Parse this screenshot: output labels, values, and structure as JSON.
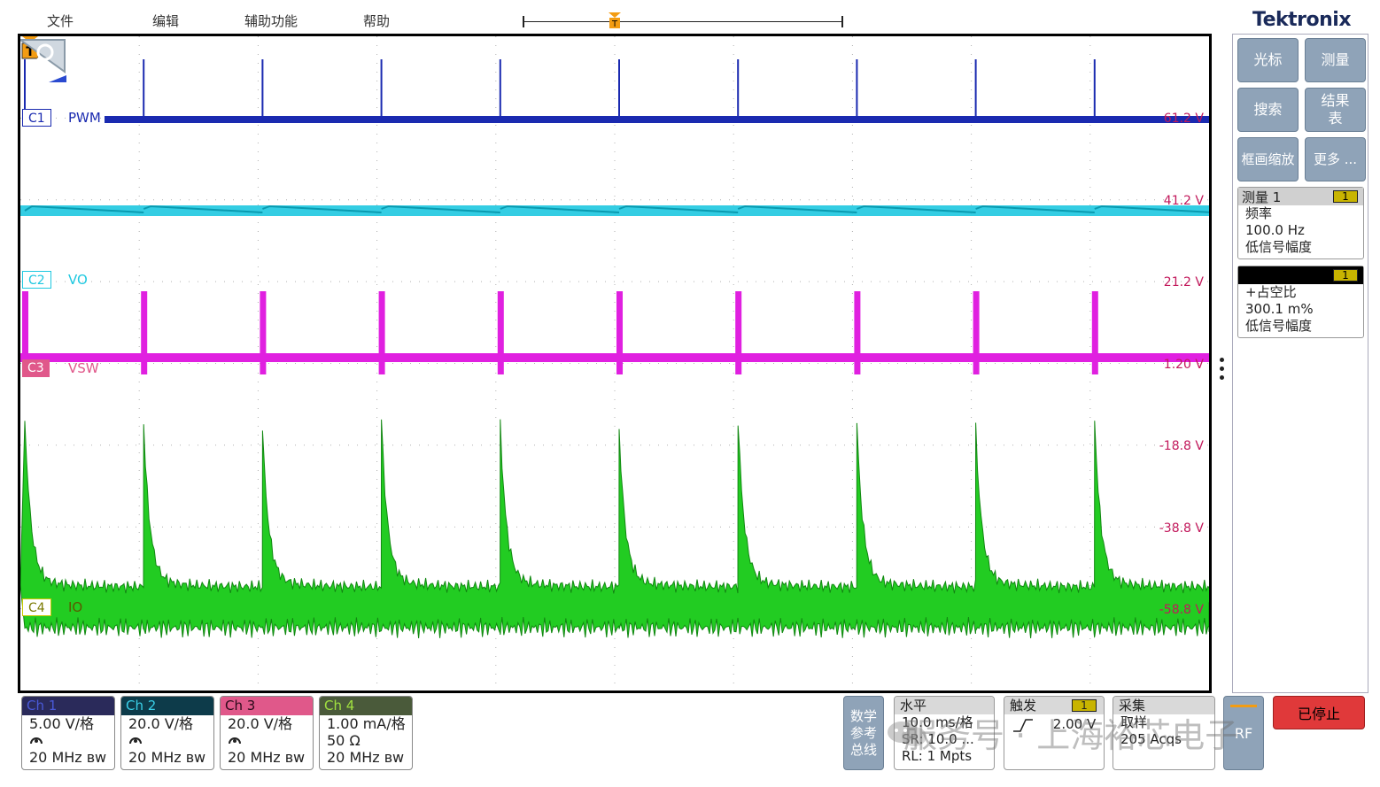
{
  "menu": {
    "file": "文件",
    "edit": "编辑",
    "utility": "辅助功能",
    "help": "帮助"
  },
  "brand": "Tektronix",
  "trigger_marker_label": "T",
  "channels": [
    {
      "tag": "C1",
      "name": "PWM",
      "color": "#1a2ab0"
    },
    {
      "tag": "C2",
      "name": "VO",
      "color": "#1ec8e0"
    },
    {
      "tag": "C3",
      "name": "VSW",
      "color": "#e020e0"
    },
    {
      "tag": "C4",
      "name": "IO",
      "color": "#22cc22"
    }
  ],
  "scale_labels": [
    "61.2 V",
    "41.2 V",
    "21.2 V",
    "1.20 V",
    "-18.8 V",
    "-38.8 V",
    "-58.8 V"
  ],
  "side_buttons": {
    "cursor": "光标",
    "measure": "测量",
    "search": "搜索",
    "results_line1": "结果",
    "results_line2": "表",
    "zoom": "框画缩放",
    "more": "更多 ..."
  },
  "measurements": [
    {
      "title": "测量 1",
      "badge": "1",
      "name": "频率",
      "value": "100.0 Hz",
      "status": "低信号幅度"
    },
    {
      "title": "",
      "badge": "1",
      "name": "+占空比",
      "value": "300.1 m%",
      "status": "低信号幅度"
    }
  ],
  "channel_boxes": [
    {
      "label": "Ch 1",
      "scale": "5.00 V/格",
      "bw": "20 MHz ʙw",
      "header_bg": "#2a2a5a",
      "header_fg": "#4a5ad8"
    },
    {
      "label": "Ch 2",
      "scale": "20.0 V/格",
      "bw": "20 MHz ʙw",
      "header_bg": "#0d3b4a",
      "header_fg": "#3ad0e8"
    },
    {
      "label": "Ch 3",
      "scale": "20.0 V/格",
      "bw": "20 MHz ʙw",
      "header_bg": "#e0588a",
      "header_fg": "#2a0a1a"
    },
    {
      "label": "Ch 4",
      "scale": "1.00 mA/格",
      "impedance": "50 Ω",
      "bw": "20 MHz ʙw",
      "header_bg": "#4a5a3a",
      "header_fg": "#a0e040"
    }
  ],
  "math_ref_bus": {
    "line1": "数学",
    "line2": "参考",
    "line3": "总线"
  },
  "horizontal": {
    "title": "水平",
    "scale": "10.0 ms/格",
    "sr": "SR: 10.0 ...",
    "rl": "RL: 1 Mpts"
  },
  "trigger": {
    "title": "触发",
    "badge": "1",
    "level": "2.00 V"
  },
  "acquisition": {
    "title": "采集",
    "mode": "取样",
    "acqs": "205 Acqs"
  },
  "rf_label": "RF",
  "stopped_label": "已停止",
  "watermark": "服务号 · 上海裕芯电子",
  "icons": [
    "trigger-marker-icon",
    "zoom-magnifier-icon",
    "probe-icon",
    "trigger-edge-icon",
    "wechat-icon"
  ]
}
